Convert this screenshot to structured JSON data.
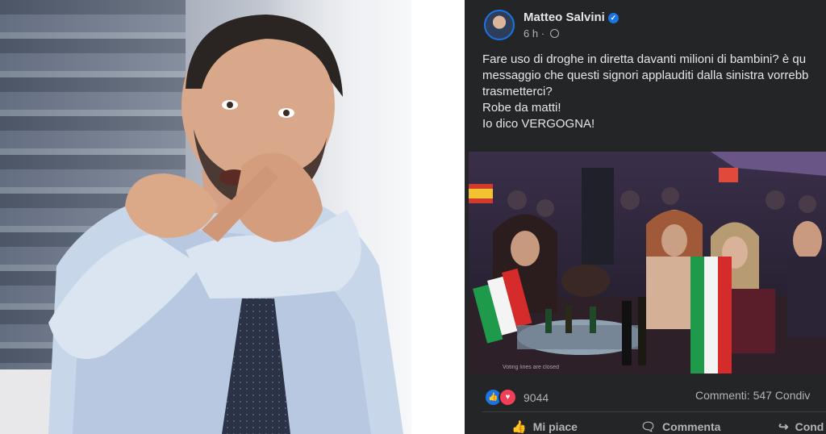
{
  "photo": {
    "alt": ""
  },
  "post": {
    "author": "Matteo Salvini",
    "verified_icon": "verified-badge-icon",
    "time": "6 h",
    "dot": "·",
    "lines": [
      "Fare uso di droghe in diretta davanti milioni di bambini? è qu",
      "messaggio che questi signori applauditi dalla sinistra vorrebb",
      "trasmetterci?",
      "Robe da matti!",
      "Io dico VERGOGNA!"
    ],
    "media_caption": "Voting lines are closed",
    "reaction_count": "9044",
    "comments": "Commenti: 547  Condiv",
    "actions": {
      "like": "Mi piace",
      "comment": "Commenta",
      "share": "Cond"
    },
    "colors": {
      "background": "#242526",
      "accent": "#1b74e4",
      "love": "#f33e58"
    }
  }
}
